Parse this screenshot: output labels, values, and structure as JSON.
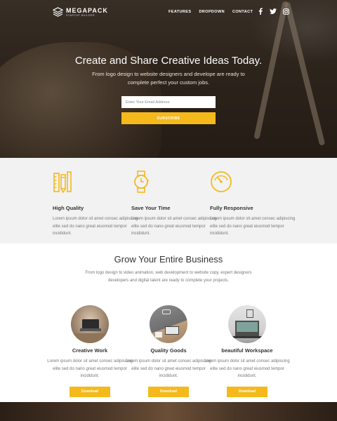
{
  "brand": {
    "name": "MEGAPACK",
    "tagline": "STARTUP BUILDER"
  },
  "nav": {
    "items": [
      "FEATURES",
      "DROPDOWN",
      "CONTACT"
    ]
  },
  "social": [
    "facebook-icon",
    "twitter-icon",
    "instagram-icon"
  ],
  "hero": {
    "title": "Create and Share Creative Ideas Today.",
    "description": "From logo design to website designers and develope are ready to complete perfect your custom jobs.",
    "email_placeholder": "Enter Your Email Address",
    "subscribe_label": "SUBSCRIBE"
  },
  "features": [
    {
      "icon": "ruler-pencil-icon",
      "title": "High Quality",
      "description": "Lorem ipsum dolor sit amet consec adipiscing elite sed do nano great eiusmod tempor incididunt."
    },
    {
      "icon": "watch-icon",
      "title": "Save Your Time",
      "description": "Lorem ipsum dolor sit amet consec adipiscing elite sed do nano great eiusmod tempor incididunt."
    },
    {
      "icon": "speedometer-icon",
      "title": "Fully Responsive",
      "description": "Lorem ipsum dolor sit amet consec adipiscing elite sed do nano great eiusmod tempor incididunt."
    }
  ],
  "grow": {
    "title": "Grow Your Entire Business",
    "description": "From logo design to video animation, web development to website copy, expert designers developers and digital talent are ready to complete your projects."
  },
  "cards": [
    {
      "title": "Creative Work",
      "description": "Lorem ipsum dolor sit amet consec adipiscing elite sed do nano great eiusmod tempor incididunt.",
      "button": "Download"
    },
    {
      "title": "Quality Goods",
      "description": "Lorem ipsum dolor sit amet consec adipiscing elite sed do nano great eiusmod tempor incididunt.",
      "button": "Download"
    },
    {
      "title": "beautiful Workspace",
      "description": "Lorem ipsum dolor sit amet consec adipiscing elite sed do nano great eiusmod tempor incididunt.",
      "button": "Download"
    }
  ],
  "colors": {
    "accent": "#f5b91c",
    "features_bg": "#f2f2f2"
  }
}
